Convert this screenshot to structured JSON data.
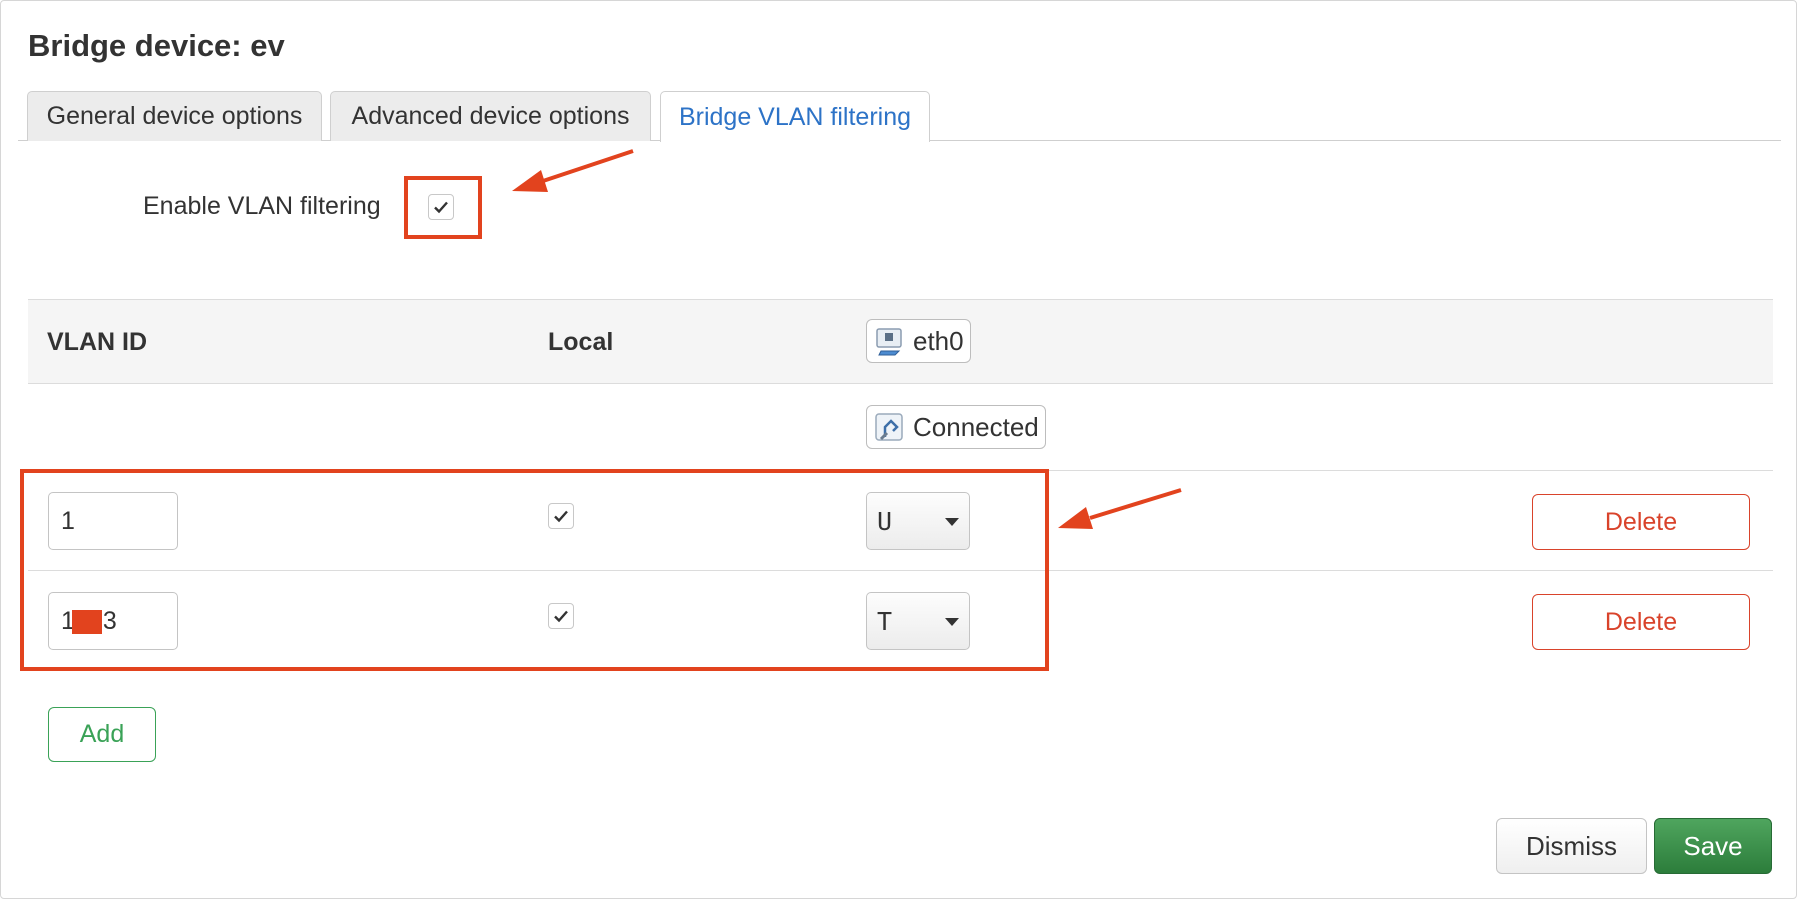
{
  "dialog": {
    "title": "Bridge device: ev"
  },
  "tabs": [
    {
      "label": "General device options",
      "active": false
    },
    {
      "label": "Advanced device options",
      "active": false
    },
    {
      "label": "Bridge VLAN filtering",
      "active": true
    }
  ],
  "vlan_filtering": {
    "label": "Enable VLAN filtering",
    "checked": true
  },
  "table": {
    "headers": {
      "vlan_id": "VLAN ID",
      "local": "Local",
      "port": "eth0"
    },
    "port_status": "Connected",
    "rows": [
      {
        "vlan_id": "1",
        "local": true,
        "mode": "U",
        "delete_label": "Delete"
      },
      {
        "vlan_id_prefix": "1",
        "vlan_id_suffix": "3",
        "vlan_id_redacted": true,
        "local": true,
        "mode": "T",
        "delete_label": "Delete"
      }
    ]
  },
  "buttons": {
    "add": "Add",
    "dismiss": "Dismiss",
    "save": "Save"
  },
  "icons": {
    "port": "network-port-icon",
    "status": "ethernet-connected-icon",
    "check": "checkmark-icon"
  },
  "colors": {
    "annotation": "#e2431e",
    "active_tab": "#2d73c7",
    "delete": "#d9432b",
    "add": "#3aa257",
    "save": "#2c7d3b"
  }
}
